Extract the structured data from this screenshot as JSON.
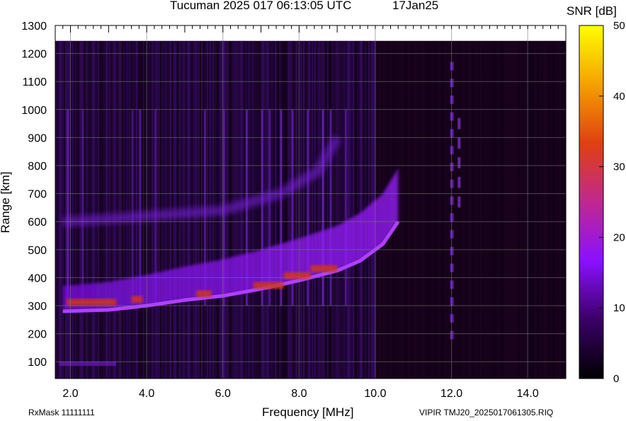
{
  "header": {
    "title": "Tucuman 2025 017 06:13:05 UTC",
    "date": "17Jan25"
  },
  "footer": {
    "rxmask": "RxMask 11111111",
    "fileinfo": "VIPIR  TMJ20_2025017061305.RIQ"
  },
  "chart_data": {
    "type": "heatmap",
    "title": "Tucuman 2025 017 06:13:05 UTC",
    "xlabel": "Frequency [MHz]",
    "ylabel": "Range [km]",
    "xlim": [
      1.6,
      15.0
    ],
    "ylim": [
      40,
      1300
    ],
    "x_ticks": [
      2.0,
      4.0,
      6.0,
      8.0,
      10.0,
      12.0,
      14.0
    ],
    "x_tick_labels": [
      "2.0",
      "4.0",
      "6.0",
      "8.0",
      "10.0",
      "12.0",
      "14.0"
    ],
    "y_ticks": [
      100,
      200,
      300,
      400,
      500,
      600,
      700,
      800,
      900,
      1000,
      1100,
      1200,
      1300
    ],
    "grid": true,
    "colorbar": {
      "label": "SNR [dB]",
      "range": [
        0,
        50
      ],
      "ticks": [
        0,
        10,
        20,
        30,
        40,
        50
      ],
      "colors": [
        "#000000",
        "#3a0066",
        "#8a10ff",
        "#c02890",
        "#e04010",
        "#f5a000",
        "#ffff00"
      ]
    },
    "features": {
      "f_layer_trace": {
        "description_points_freq_mhz": [
          1.8,
          3.0,
          4.0,
          5.0,
          6.0,
          7.0,
          8.0,
          9.0,
          9.6,
          10.2,
          10.6
        ],
        "virtual_height_km": [
          280,
          285,
          300,
          320,
          335,
          360,
          390,
          425,
          460,
          520,
          600
        ]
      },
      "upper_echo": {
        "freq_mhz": [
          1.8,
          3.0,
          4.0,
          6.0,
          7.5,
          8.5,
          9.0
        ],
        "virtual_height_km": [
          600,
          610,
          620,
          640,
          700,
          780,
          900
        ]
      }
    }
  }
}
